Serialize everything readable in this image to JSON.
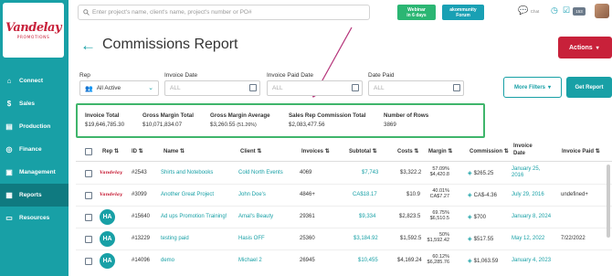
{
  "brand": {
    "logo_text": "Vandelay",
    "logo_sub": "PROMOTIONS",
    "colors": {
      "accent": "#18a0a6",
      "danger": "#c8213a",
      "success": "#3fb56b"
    }
  },
  "sidebar": {
    "items": [
      {
        "label": "Connect",
        "icon": "connect-icon"
      },
      {
        "label": "Sales",
        "icon": "dollar-icon"
      },
      {
        "label": "Production",
        "icon": "production-icon"
      },
      {
        "label": "Finance",
        "icon": "finance-icon"
      },
      {
        "label": "Management",
        "icon": "management-icon"
      },
      {
        "label": "Reports",
        "icon": "reports-icon",
        "active": true
      },
      {
        "label": "Resources",
        "icon": "resources-icon"
      }
    ]
  },
  "topbar": {
    "search_placeholder": "Enter project's name, client's name, project's number or PO#",
    "webinar_line1": "Webinar",
    "webinar_line2": "in 6 days",
    "community_line1": "akommunity",
    "community_line2": "Forum",
    "chat_label": "Chat",
    "notification_count": "153"
  },
  "header": {
    "title": "Commissions Report",
    "actions_label": "Actions"
  },
  "filters": {
    "rep_label": "Rep",
    "rep_value": "All Active",
    "invoice_date_label": "Invoice Date",
    "invoice_date_value": "ALL",
    "invoice_paid_label": "Invoice Paid Date",
    "invoice_paid_value": "ALL",
    "date_paid_label": "Date Paid",
    "date_paid_value": "ALL",
    "more_filters_label": "More Filters",
    "get_report_label": "Get Report"
  },
  "summary": {
    "invoice_total_label": "Invoice Total",
    "invoice_total_value": "$19,646,785.30",
    "gross_margin_total_label": "Gross Margin Total",
    "gross_margin_total_value": "$10,071,834.07",
    "gross_margin_avg_label": "Gross Margin Average",
    "gross_margin_avg_value": "$3,260.55",
    "gross_margin_avg_pct": "(51.26%)",
    "sales_rep_commission_label": "Sales Rep Commission Total",
    "sales_rep_commission_value": "$2,083,477.56",
    "rows_label": "Number of Rows",
    "rows_value": "3869"
  },
  "table": {
    "headers": {
      "rep": "Rep",
      "id": "ID",
      "name": "Name",
      "client": "Client",
      "invoices": "Invoices",
      "subtotal": "Subtotal",
      "costs": "Costs",
      "margin": "Margin",
      "commission": "Commission",
      "invoice_date_1": "Invoice",
      "invoice_date_2": "Date",
      "invoice_paid": "Invoice Paid"
    },
    "rows": [
      {
        "rep": "Vandelay",
        "id": "#2543",
        "name": "Shirts and Notebooks",
        "client": "Cold North Events",
        "invoices": "4069",
        "subtotal": "$7,743",
        "costs": "$3,322.2",
        "margin_pct": "57.09%",
        "margin_val": "$4,420.8",
        "commission": "$265.25",
        "invoice_date_1": "January 25,",
        "invoice_date_2": "2016",
        "invoice_paid": ""
      },
      {
        "rep": "Vandelay",
        "id": "#3099",
        "name": "Another Great Project",
        "client": "John Doe's",
        "invoices": "4846+",
        "subtotal": "CA$18.17",
        "costs": "$10.9",
        "margin_pct": "40.01%",
        "margin_val": "CA$7.27",
        "commission": "CA$-4.36",
        "invoice_date_1": "July 29, 2016",
        "invoice_date_2": "",
        "invoice_paid": "undefined+"
      },
      {
        "rep": "HA",
        "id": "#15640",
        "name": "Ad ups Promotion Training!",
        "client": "Amal's Beauty",
        "invoices": "29361",
        "subtotal": "$9,334",
        "costs": "$2,823.5",
        "margin_pct": "69.75%",
        "margin_val": "$6,510.5",
        "commission": "$700",
        "invoice_date_1": "January 8, 2024",
        "invoice_date_2": "",
        "invoice_paid": ""
      },
      {
        "rep": "HA",
        "id": "#13229",
        "name": "testing paid",
        "client": "Hasis OFF",
        "invoices": "25360",
        "subtotal": "$3,184.92",
        "costs": "$1,592.5",
        "margin_pct": "50%",
        "margin_val": "$1,592.42",
        "commission": "$517.55",
        "invoice_date_1": "May 12, 2022",
        "invoice_date_2": "",
        "invoice_paid": "7/22/2022"
      },
      {
        "rep": "HA",
        "id": "#14096",
        "name": "demo",
        "client": "Michael 2",
        "invoices": "26945",
        "subtotal": "$10,455",
        "costs": "$4,169.24",
        "margin_pct": "60.12%",
        "margin_val": "$6,285.76",
        "commission": "$1,063.59",
        "invoice_date_1": "January 4, 2023",
        "invoice_date_2": "",
        "invoice_paid": ""
      }
    ]
  }
}
